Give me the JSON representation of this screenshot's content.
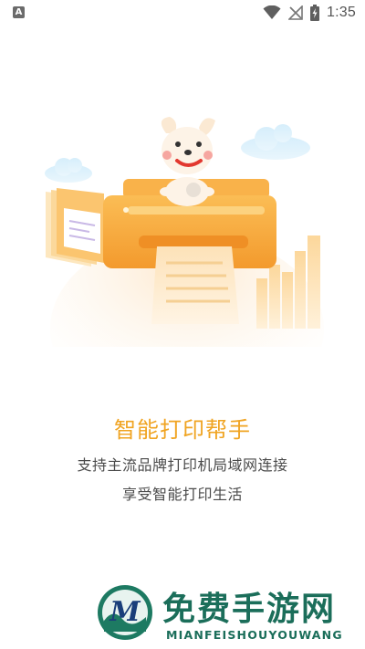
{
  "status_bar": {
    "app_icon_letter": "A",
    "time": "1:35"
  },
  "main": {
    "headline": "智能打印帮手",
    "subline_1": "支持主流品牌打印机局域网连接",
    "subline_2": "享受智能打印生活"
  },
  "watermark": {
    "title": "免费手游网",
    "subtitle": "MIANFEISHOUYOUWANG"
  },
  "colors": {
    "accent": "#f0a422",
    "printer_orange": "#f6a73a",
    "watermark_green": "#1b6e5a"
  },
  "icons": [
    "wifi-icon",
    "signal-off-icon",
    "battery-charging-icon",
    "printer-illustration"
  ]
}
